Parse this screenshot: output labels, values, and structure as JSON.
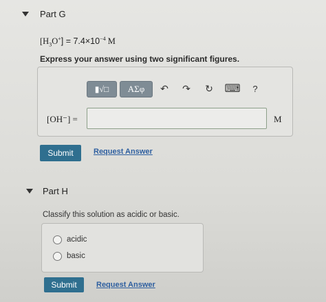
{
  "part_g": {
    "title": "Part G",
    "given_prefix": "[H",
    "given_sub": "3",
    "given_mid": "O",
    "given_sup1": "+",
    "given_eq": "] = 7.4×10",
    "given_exp": "−4",
    "given_unit": "M",
    "instruction": "Express your answer using two significant figures.",
    "toolbar": {
      "templates_label": "▮√□",
      "symbols_label": "ΑΣφ",
      "undo_glyph": "↶",
      "redo_glyph": "↷",
      "reset_glyph": "↻",
      "keyboard_glyph": "⌨",
      "help_glyph": "?"
    },
    "input_label": "[OH⁻] =",
    "input_value": "",
    "unit": "M",
    "submit_label": "Submit",
    "request_label": "Request Answer"
  },
  "part_h": {
    "title": "Part H",
    "question": "Classify this solution as acidic or basic.",
    "options": [
      "acidic",
      "basic"
    ],
    "submit_label": "Submit",
    "request_label": "Request Answer"
  }
}
